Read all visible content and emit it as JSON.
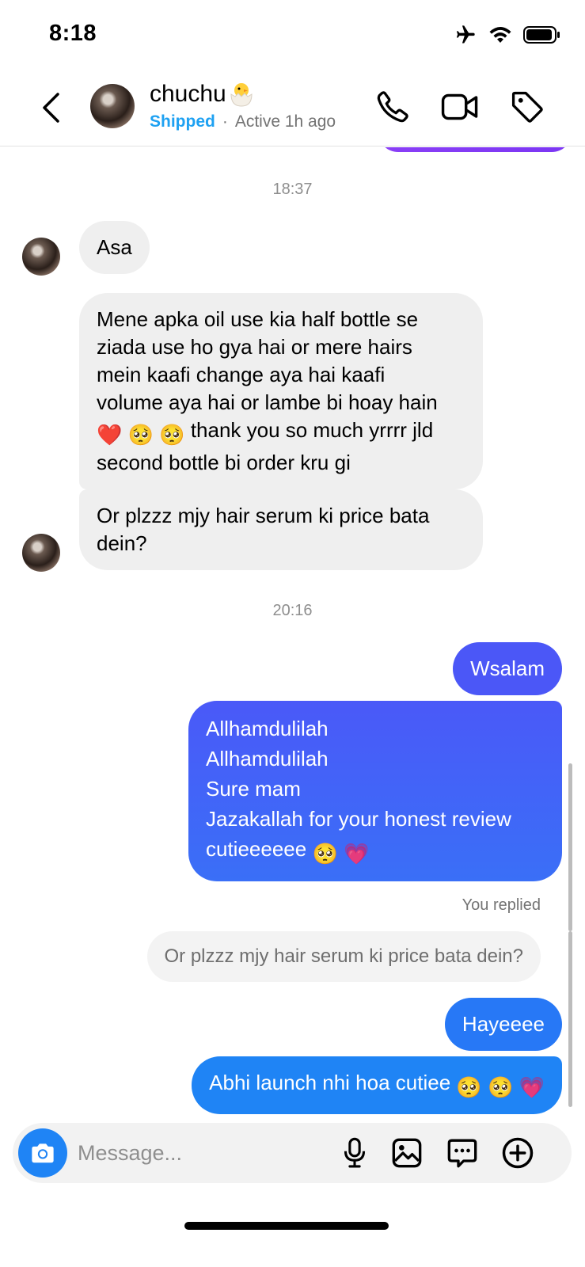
{
  "status_bar": {
    "time": "8:18"
  },
  "header": {
    "contact_name": "chuchu",
    "label": "Shipped",
    "separator": "·",
    "activity": "Active 1h ago"
  },
  "chat": {
    "messages": [
      {
        "type": "timestamp",
        "text": "18:37"
      },
      {
        "type": "incoming",
        "text": "Asa"
      },
      {
        "type": "incoming",
        "lines": [
          "Mene apka oil use kia half bottle se",
          "ziada use ho gya hai or mere hairs",
          "mein kaafi change aya hai kaafi",
          "volume aya hai or lambe bi hoay hain",
          "thank you so much yrrrr jld",
          "second bottle bi order kru gi"
        ],
        "emoji_before_line5": [
          "❤️",
          "🥺",
          "🥺"
        ]
      },
      {
        "type": "incoming",
        "lines": [
          "Or plzzz mjy hair serum ki price bata",
          "dein?"
        ]
      },
      {
        "type": "timestamp",
        "text": "20:16"
      },
      {
        "type": "outgoing",
        "text": "Wsalam"
      },
      {
        "type": "outgoing",
        "lines": [
          "Allhamdulilah",
          "Allhamdulilah",
          "Sure mam",
          "Jazakallah for your honest review",
          "cutieeeeee"
        ],
        "emoji_after_last": [
          "🥺",
          "💗"
        ]
      },
      {
        "type": "reply_label",
        "text": "You replied"
      },
      {
        "type": "reply_quote",
        "text": "Or plzzz mjy hair serum ki price bata dein?"
      },
      {
        "type": "outgoing",
        "text": "Hayeeee"
      },
      {
        "type": "outgoing",
        "text": "Abhi launch nhi hoa cutiee",
        "emoji_after": [
          "🥺",
          "🥺",
          "💗"
        ]
      }
    ]
  },
  "composer": {
    "placeholder": "Message..."
  },
  "colors": {
    "outgoing_purple": "#4b57f7",
    "outgoing_blue": "#1f84f5",
    "incoming_bg": "#efefef",
    "label_blue": "#1ea1f2"
  },
  "icons": [
    "back-icon",
    "phone-icon",
    "video-icon",
    "tag-icon",
    "camera-icon",
    "mic-icon",
    "gallery-icon",
    "sticker-icon",
    "plus-icon"
  ]
}
